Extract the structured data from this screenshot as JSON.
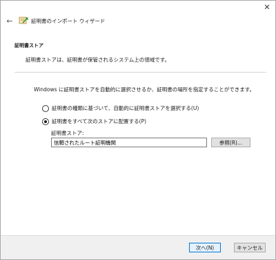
{
  "window": {
    "title": "証明書のインポート ウィザード",
    "close_glyph": "✕",
    "back_glyph": "←",
    "icons": {
      "close": "close-icon",
      "back": "back-arrow-icon",
      "app": "certificate-wizard-icon"
    }
  },
  "header": {
    "title": "証明書ストア",
    "description": "証明書ストアは、証明書が保管されるシステム上の領域です。"
  },
  "body": {
    "intro": "Windows に証明書ストアを自動的に選択させるか、証明書の場所を指定することができます。",
    "option_auto": {
      "label": "証明書の種類に基づいて、自動的に証明書ストアを選択する(U)",
      "selected": false
    },
    "option_manual": {
      "label": "証明書をすべて次のストアに配置する(P)",
      "selected": true
    },
    "store_label": "証明書ストア:",
    "store_value": "信頼されたルート証明機関",
    "browse_label": "参照(R)..."
  },
  "footer": {
    "next_label": "次へ(N)",
    "cancel_label": "キャンセル"
  }
}
